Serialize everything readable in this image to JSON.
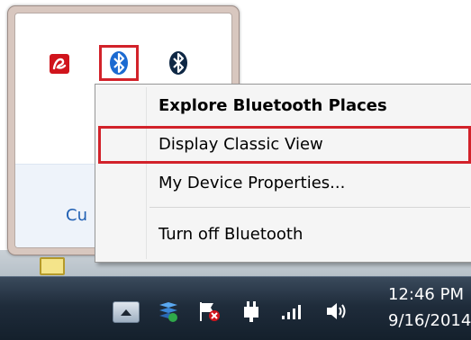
{
  "flyout": {
    "icons": [
      "avira-icon",
      "bluetooth-icon",
      "bluetooth-icon"
    ],
    "customize_link": "Cu"
  },
  "context_menu": {
    "items": [
      {
        "label": "Explore Bluetooth Places",
        "bold": true
      },
      {
        "label": "Display Classic View",
        "highlighted": true
      },
      {
        "label": "My Device Properties..."
      },
      {
        "label": "Turn off Bluetooth"
      }
    ]
  },
  "taskbar": {
    "tray_icons": [
      "show-hidden-icons-arrow-icon",
      "network-sharing-icon",
      "action-center-flag-icon",
      "power-plug-icon",
      "signal-bars-icon",
      "speaker-volume-icon"
    ],
    "clock": {
      "time": "12:46 PM",
      "date": "9/16/2014"
    }
  },
  "colors": {
    "highlight_box": "#d2222a",
    "bluetooth": "#1b6ad1",
    "avira": "#d0141c",
    "taskbar": "#1f2c3b"
  }
}
